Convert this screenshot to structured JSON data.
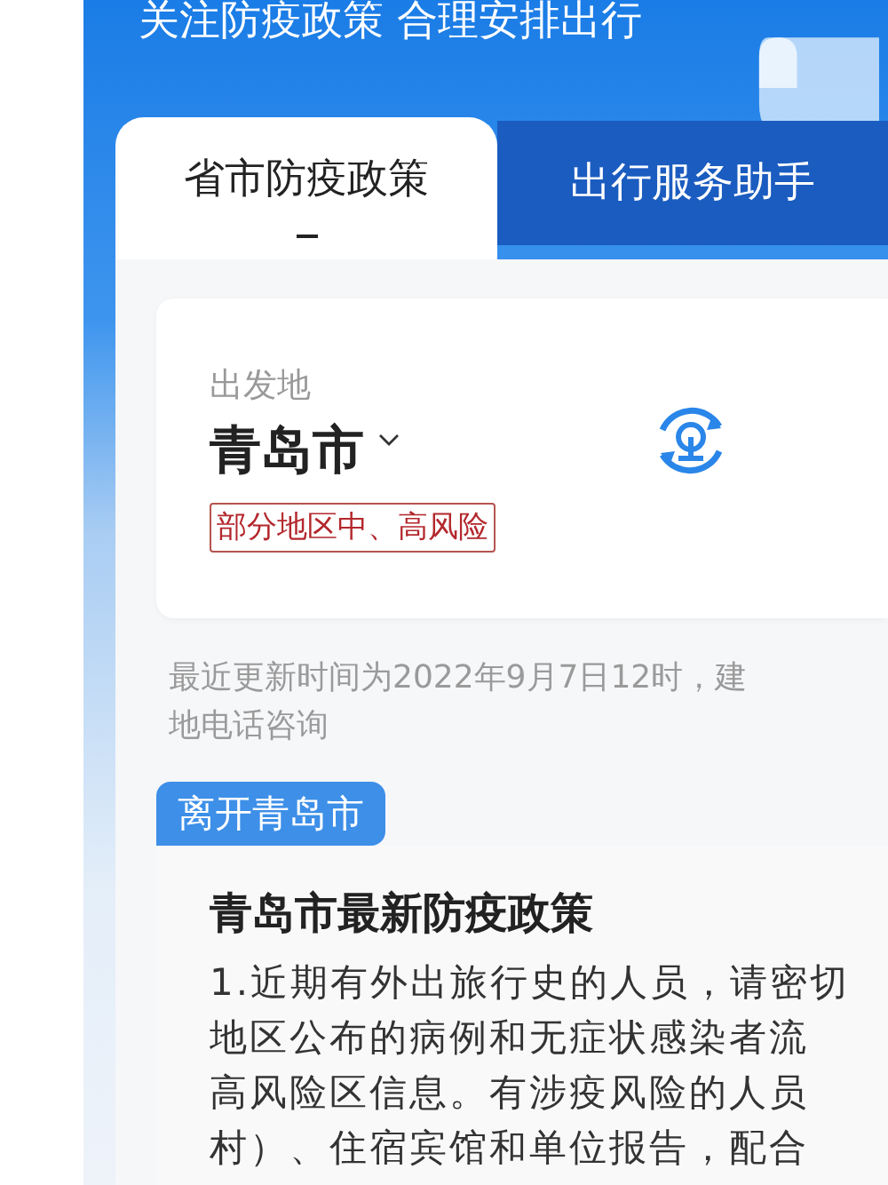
{
  "header": {
    "slogan": "关注防疫政策 合理安排出行"
  },
  "tabs": [
    {
      "label": "省市防疫政策",
      "selected": true
    },
    {
      "label": "出行服务助手",
      "selected": false
    }
  ],
  "departure": {
    "label": "出发地",
    "city": "青岛市",
    "risk_tag": "部分地区中、高风险"
  },
  "update_note": [
    "最近更新时间为2022年9月7日12时，建",
    "地电话咨询"
  ],
  "section": {
    "tab": "离开青岛市",
    "title": "青岛市最新防疫政策",
    "lines": [
      "1.近期有外出旅行史的人员，请密切",
      "地区公布的病例和无症状感染者流",
      "高风险区信息。有涉疫风险的人员",
      "村）、住宿宾馆和单位报告，配合"
    ]
  }
}
